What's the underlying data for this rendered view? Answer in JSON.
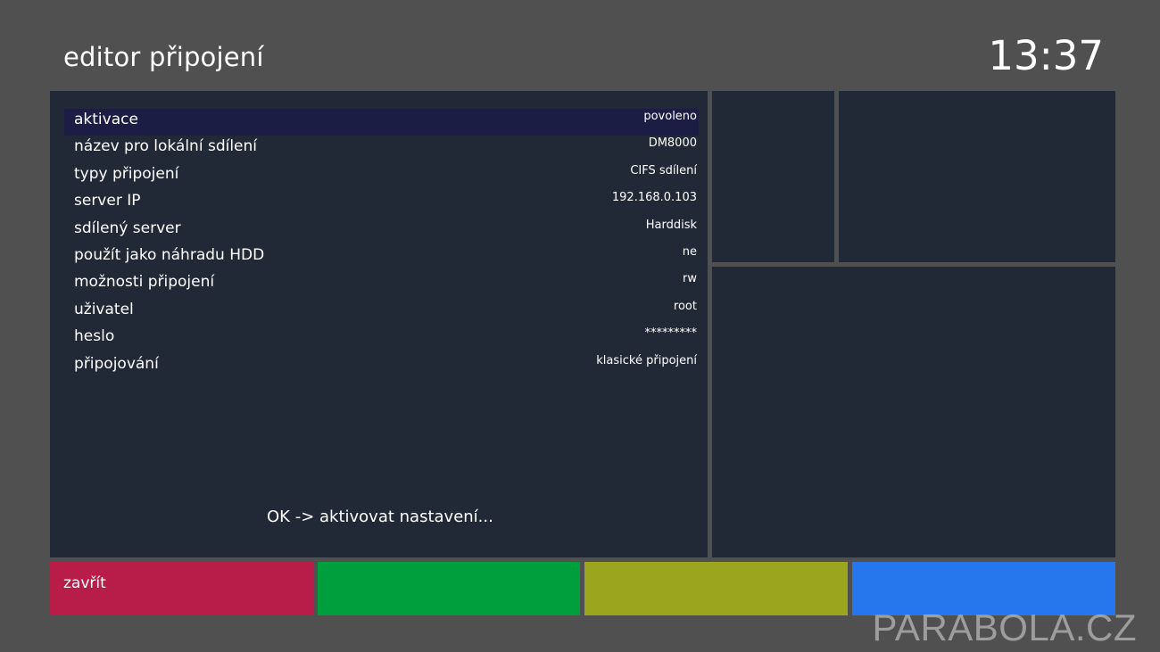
{
  "header": {
    "title": "editor připojení",
    "clock": "13:37"
  },
  "config": {
    "items": [
      {
        "label": "aktivace",
        "value": "povoleno"
      },
      {
        "label": "název pro lokální sdílení",
        "value": "DM8000"
      },
      {
        "label": "typy připojení",
        "value": "CIFS sdílení"
      },
      {
        "label": "server IP",
        "value": "192.168.0.103"
      },
      {
        "label": "sdílený server",
        "value": "Harddisk"
      },
      {
        "label": "použít jako náhradu HDD",
        "value": "ne"
      },
      {
        "label": "možnosti připojení",
        "value": "rw"
      },
      {
        "label": "uživatel",
        "value": "root"
      },
      {
        "label": "heslo",
        "value": "*********"
      },
      {
        "label": "připojování",
        "value": "klasické připojení"
      }
    ],
    "hint": "OK -> aktivovat nastavení..."
  },
  "color_keys": {
    "red_label": "zavřít",
    "green_label": "",
    "yellow_label": "",
    "blue_label": ""
  },
  "colors": {
    "background": "#505050",
    "panel": "#212936",
    "selection": "#1c1d45",
    "red": "#b81c48",
    "green": "#009f3e",
    "yellow": "#9ca51e",
    "blue": "#2676ee"
  },
  "watermark": "PARABOLA.CZ"
}
